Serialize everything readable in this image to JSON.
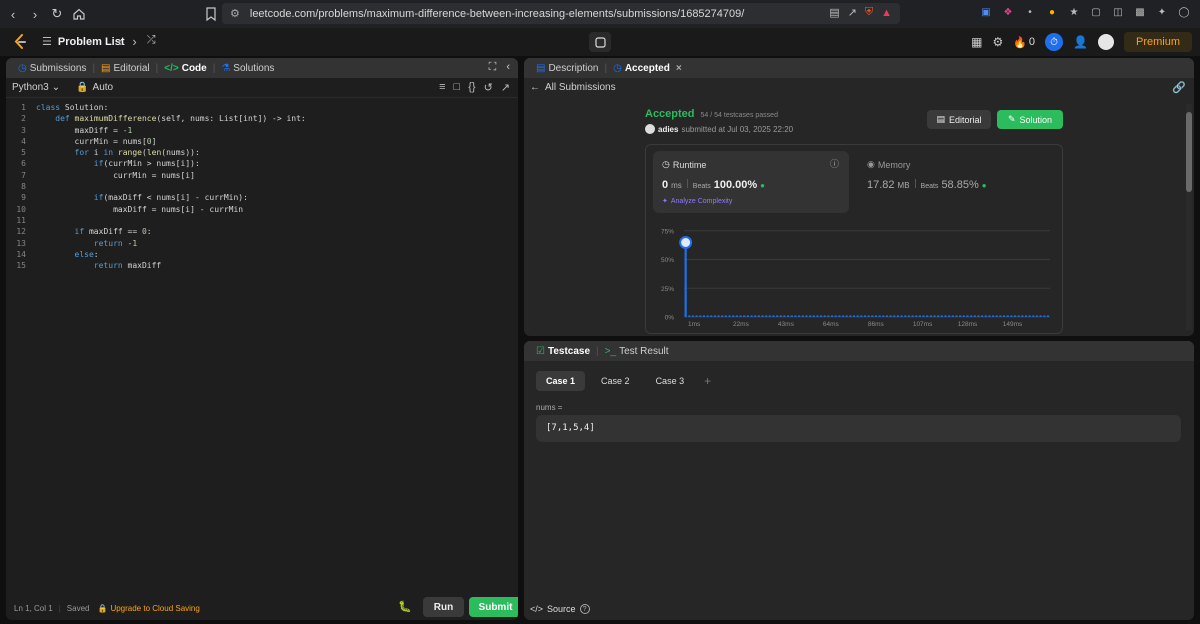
{
  "browser": {
    "url": "leetcode.com/problems/maximum-difference-between-increasing-elements/submissions/1685274709/"
  },
  "topbar": {
    "problem_list": "Problem List",
    "streak_count": "0",
    "premium": "Premium"
  },
  "left": {
    "tabs": {
      "submissions": "Submissions",
      "editorial": "Editorial",
      "code": "Code",
      "solutions": "Solutions"
    },
    "language": "Python3",
    "mode": "Auto",
    "code_lines": [
      "class Solution:",
      "    def maximumDifference(self, nums: List[int]) -> int:",
      "        maxDiff = -1",
      "        currMin = nums[0]",
      "        for i in range(len(nums)):",
      "            if(currMin > nums[i]):",
      "                currMin = nums[i]",
      "",
      "            if(maxDiff < nums[i] - currMin):",
      "                maxDiff = nums[i] - currMin",
      "",
      "        if maxDiff == 0:",
      "            return -1",
      "        else:",
      "            return maxDiff"
    ],
    "line_numbers": [
      "1",
      "2",
      "3",
      "4",
      "5",
      "6",
      "7",
      "8",
      "9",
      "10",
      "11",
      "12",
      "13",
      "14",
      "15"
    ],
    "status": {
      "position": "Ln 1, Col 1",
      "saved": "Saved",
      "upgrade": "Upgrade to Cloud Saving"
    },
    "run": "Run",
    "submit": "Submit"
  },
  "right_top": {
    "tabs": {
      "description": "Description",
      "accepted": "Accepted"
    },
    "all_submissions": "All Submissions",
    "status": "Accepted",
    "testcases": "54 / 54 testcases passed",
    "user": "adies",
    "submitted_at": "submitted at Jul 03, 2025 22:20",
    "editorial_btn": "Editorial",
    "solution_btn": "Solution",
    "runtime": {
      "title": "Runtime",
      "value": "0",
      "unit": "ms",
      "beats_label": "Beats",
      "beats": "100.00%",
      "analyze": "Analyze Complexity"
    },
    "memory": {
      "title": "Memory",
      "value": "17.82",
      "unit": "MB",
      "beats_label": "Beats",
      "beats": "58.85%"
    }
  },
  "chart_data": {
    "type": "bar",
    "categories": [
      "1ms",
      "22ms",
      "43ms",
      "64ms",
      "86ms",
      "107ms",
      "128ms",
      "149ms"
    ],
    "y_ticks": [
      "75%",
      "50%",
      "25%",
      "0%"
    ],
    "ylim": [
      0,
      0.8
    ],
    "first_bar_value": 0.7,
    "small_bar_value": 0.01,
    "bar_count": 100,
    "highlight_index": 0,
    "accent": "#1f6feb"
  },
  "right_bottom": {
    "tabs": {
      "testcase": "Testcase",
      "test_result": "Test Result"
    },
    "cases": [
      "Case 1",
      "Case 2",
      "Case 3"
    ],
    "var_name": "nums =",
    "var_value": "[7,1,5,4]",
    "source": "Source"
  }
}
